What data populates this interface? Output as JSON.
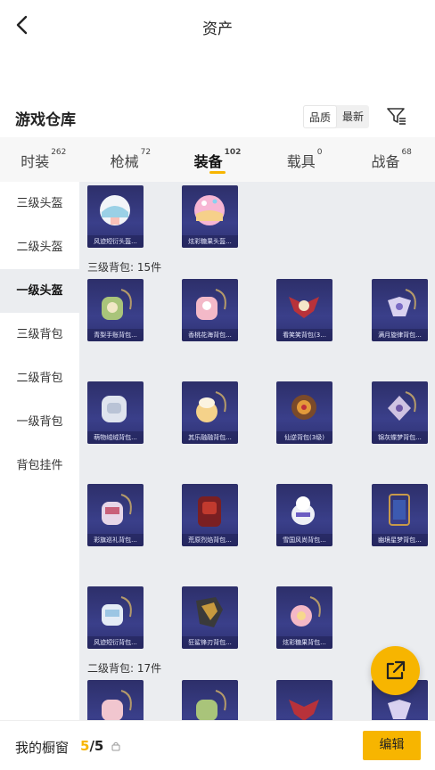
{
  "header": {
    "title": "资产"
  },
  "warehouse": {
    "title": "游戏仓库",
    "sort_quality": "品质",
    "sort_latest": "最新"
  },
  "tabs": [
    {
      "label": "时装",
      "count": "262"
    },
    {
      "label": "枪械",
      "count": "72"
    },
    {
      "label": "装备",
      "count": "102"
    },
    {
      "label": "载具",
      "count": "0"
    },
    {
      "label": "战备",
      "count": "68"
    }
  ],
  "sidebar": [
    {
      "label": "三级头盔"
    },
    {
      "label": "二级头盔"
    },
    {
      "label": "一级头盔"
    },
    {
      "label": "三级背包"
    },
    {
      "label": "二级背包"
    },
    {
      "label": "一级背包"
    },
    {
      "label": "背包挂件"
    }
  ],
  "sections": {
    "level3_backpack": "三级背包: 15件",
    "level2_backpack": "二级背包: 17件"
  },
  "items": {
    "helmet_1": "风迹短衍头盔...",
    "helmet_2": "炫彩糖果头盔...",
    "bp_1": "青梨手账背包...",
    "bp_2": "香桃花海背包...",
    "bp_3": "看笑笑背包(3...",
    "bp_4": "满月旋律背包...",
    "bp_5": "萌物绒绒背包...",
    "bp_6": "其乐融融背包...",
    "bp_7": "仙逆背包(3级)",
    "bp_8": "锦灰蝶梦背包...",
    "bp_9": "彩旗巡礼背包...",
    "bp_10": "荒原烈焰背包...",
    "bp_11": "雪国风尚背包...",
    "bp_12": "幽境星梦背包...",
    "bp_13": "风迹短衍背包...",
    "bp_14": "狂鲨锋刃背包...",
    "bp_15": "炫彩糖果背包..."
  },
  "bottom": {
    "window_label": "我的橱窗",
    "window_current": "5",
    "window_sep": "/",
    "window_total": "5",
    "edit_label": "编辑"
  },
  "colors": {
    "accent": "#f7b500",
    "card_bg": "#2d2f6a",
    "content_bg": "#ebedf0"
  },
  "icons": {
    "back": "chevron-left-icon",
    "filter": "filter-icon",
    "share": "share-external-icon",
    "lock": "lock-icon"
  }
}
